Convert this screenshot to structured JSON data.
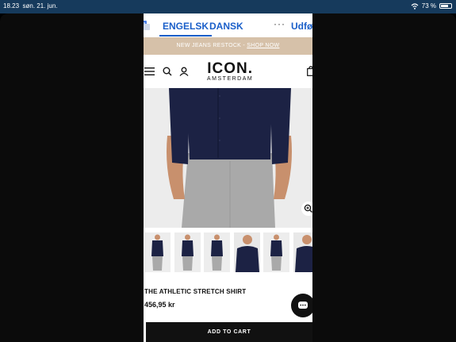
{
  "status": {
    "time": "18.23",
    "date": "søn. 21. jun.",
    "battery": "73 %",
    "battery_level": 0.73
  },
  "translate": {
    "icon": "google-translate-icon",
    "lang_1": "ENGELSK",
    "lang_2": "DANSK",
    "more": "···",
    "done": "Udfør"
  },
  "promo": {
    "text": "NEW JEANS RESTOCK - ",
    "link": "SHOP NOW"
  },
  "header": {
    "logo_main": "ICON.",
    "logo_sub": "AMSTERDAM",
    "icons": [
      "menu-icon",
      "search-icon",
      "account-icon",
      "bag-icon"
    ]
  },
  "product": {
    "title": "THE ATHLETIC STRETCH SHIRT",
    "price": "456,95 kr",
    "add_to_cart": "ADD TO CART",
    "thumbnail_count": 6,
    "selected_thumbnail": 1
  },
  "colors": {
    "shirt": "#1c2244",
    "pants": "#a9a9a9",
    "skin": "#c8906d",
    "promo_bg": "#d6c1a9",
    "accent_blue": "#1a5fc9"
  }
}
